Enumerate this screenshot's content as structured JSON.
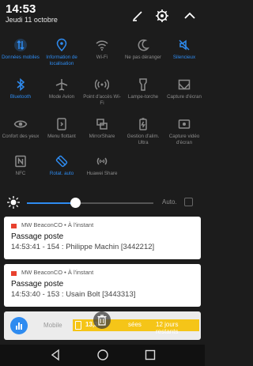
{
  "status": {
    "time": "14:53",
    "date": "Jeudi 11 octobre"
  },
  "header_icons": [
    "edit-icon",
    "settings-icon",
    "collapse-icon"
  ],
  "toggles": [
    {
      "name": "donnees-mobiles",
      "label": "Données mobiles",
      "icon": "arrows-icon",
      "on": true
    },
    {
      "name": "localisation",
      "label": "Information de localisation",
      "icon": "location-icon",
      "on": true
    },
    {
      "name": "wifi",
      "label": "Wi-Fi",
      "icon": "wifi-icon",
      "on": false
    },
    {
      "name": "ne-pas-deranger",
      "label": "Ne pas déranger",
      "icon": "moon-icon",
      "on": false
    },
    {
      "name": "silencieux",
      "label": "Silencieux",
      "icon": "mute-icon",
      "on": true
    },
    {
      "name": "bluetooth",
      "label": "Bluetooth",
      "icon": "bluetooth-icon",
      "on": true
    },
    {
      "name": "mode-avion",
      "label": "Mode Avion",
      "icon": "airplane-icon",
      "on": false
    },
    {
      "name": "point-acces",
      "label": "Point d'accès Wi-Fi",
      "icon": "hotspot-icon",
      "on": false
    },
    {
      "name": "lampe-torche",
      "label": "Lampe-torche",
      "icon": "flashlight-icon",
      "on": false
    },
    {
      "name": "capture-ecran",
      "label": "Capture d'écran",
      "icon": "screenshot-icon",
      "on": false
    },
    {
      "name": "confort-yeux",
      "label": "Confort des yeux",
      "icon": "eye-icon",
      "on": false
    },
    {
      "name": "menu-flottant",
      "label": "Menu flottant",
      "icon": "floating-menu-icon",
      "on": false
    },
    {
      "name": "mirrorshare",
      "label": "MirrorShare",
      "icon": "mirror-icon",
      "on": false
    },
    {
      "name": "gestion-alim",
      "label": "Gestion d'alim. Ultra",
      "icon": "battery-saver-icon",
      "on": false
    },
    {
      "name": "capture-video",
      "label": "Capture vidéo d'écran",
      "icon": "video-capture-icon",
      "on": false
    },
    {
      "name": "nfc",
      "label": "NFC",
      "icon": "nfc-icon",
      "on": false
    },
    {
      "name": "rotation-auto",
      "label": "Rotat. auto",
      "icon": "rotate-icon",
      "on": true
    },
    {
      "name": "huawei-share",
      "label": "Huawei Share",
      "icon": "share-icon",
      "on": false
    }
  ],
  "brightness": {
    "level": 0.38,
    "auto_label": "Auto."
  },
  "notifications": [
    {
      "app": "MW BeaconCO • À l'instant",
      "title": "Passage poste",
      "text": "14:53:41 - 154 : Philippe Machin [3442212]"
    },
    {
      "app": "MW BeaconCO • À l'instant",
      "title": "Passage poste",
      "text": "14:53:40 - 153 : Usain Bolt [3443313]"
    }
  ],
  "data_usage": {
    "mobile_label": "Mobile",
    "value": "13,3",
    "middle": "sées",
    "days_left": "12 jours restants"
  },
  "colors": {
    "accent": "#2e8bf0",
    "off": "#8c8c8c",
    "bar": "#f5c518",
    "flag": "#e8412e"
  }
}
